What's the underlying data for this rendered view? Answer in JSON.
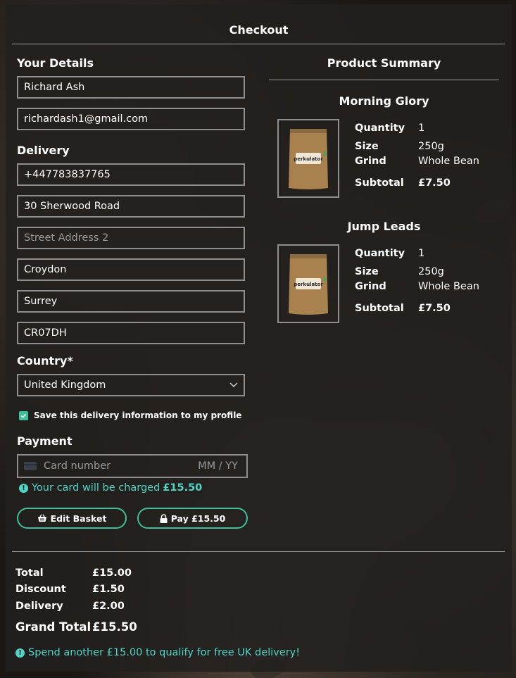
{
  "title": "Checkout",
  "details": {
    "heading": "Your Details",
    "full_name": "Richard Ash",
    "email": "richardash1@gmail.com"
  },
  "delivery": {
    "heading": "Delivery",
    "phone": "+447783837765",
    "street1": "30 Sherwood Road",
    "street2_placeholder": "Street Address 2",
    "town": "Croydon",
    "county": "Surrey",
    "postcode": "CR07DH",
    "country_label": "Country*",
    "country_value": "United Kingdom",
    "save_info_label": "Save this delivery information to my profile",
    "save_info_checked": true
  },
  "payment": {
    "heading": "Payment",
    "card_placeholder": "Card number",
    "expiry_placeholder": "MM / YY",
    "charge_text": "Your card will be charged",
    "charge_amount": "£15.50"
  },
  "buttons": {
    "edit_basket": "Edit Basket",
    "pay": "Pay £15.50"
  },
  "summary": {
    "heading": "Product Summary",
    "labels": {
      "quantity": "Quantity",
      "size": "Size",
      "grind": "Grind",
      "subtotal": "Subtotal"
    },
    "products": [
      {
        "name": "Morning Glory",
        "quantity": "1",
        "size": "250g",
        "grind": "Whole Bean",
        "subtotal": "£7.50"
      },
      {
        "name": "Jump Leads",
        "quantity": "1",
        "size": "250g",
        "grind": "Whole Bean",
        "subtotal": "£7.50"
      }
    ],
    "package_label": "perkulator"
  },
  "totals": {
    "total_label": "Total",
    "total": "£15.00",
    "discount_label": "Discount",
    "discount": "£1.50",
    "delivery_label": "Delivery",
    "delivery": "£2.00",
    "grand_total_label": "Grand Total",
    "grand_total": "£15.50",
    "free_delivery_note": "Spend another £15.00 to qualify for free UK delivery!"
  },
  "colors": {
    "accent": "#3fbf9b",
    "info": "#4fd4c6",
    "panel": "#22201e"
  }
}
